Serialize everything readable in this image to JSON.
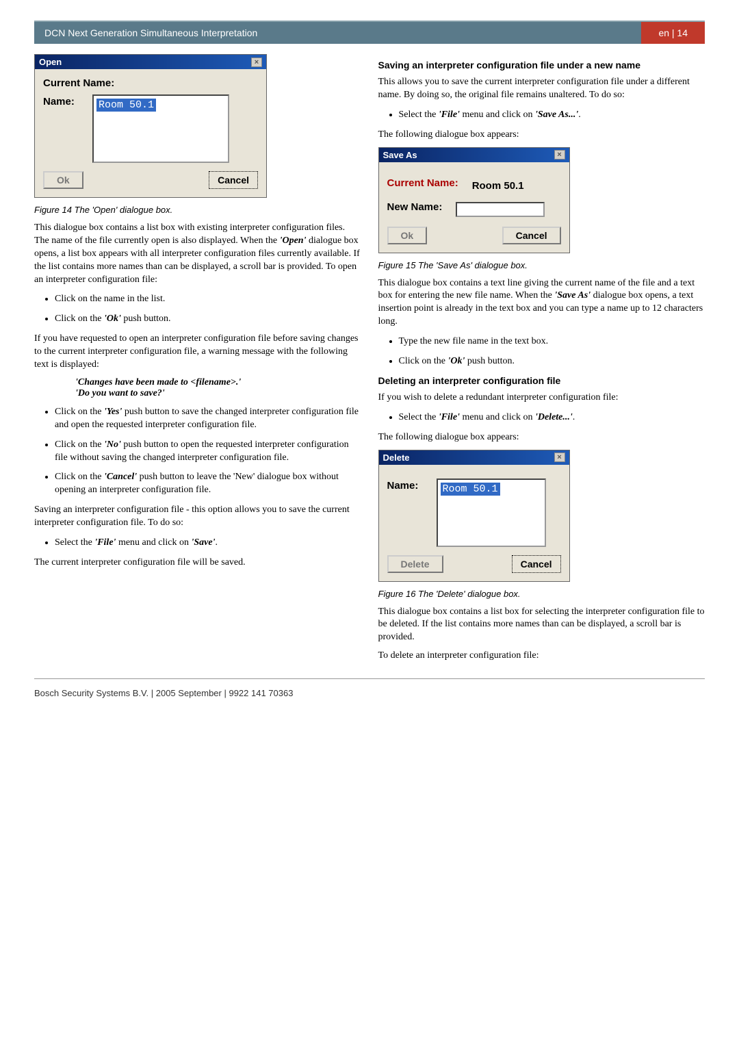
{
  "header": {
    "title": "DCN Next Generation Simultaneous Interpretation",
    "page": "en | 14"
  },
  "open_dialog": {
    "title": "Open",
    "current_name_label": "Current Name:",
    "name_label": "Name:",
    "list_value": "Room 50.1",
    "ok": "Ok",
    "cancel": "Cancel"
  },
  "fig14": "Figure 14 The 'Open' dialogue box.",
  "para1": "This dialogue box contains a list box with existing interpreter configuration files. The name of the file currently open is also displayed. When the ",
  "para1_em": "'Open'",
  "para1_cont": " dialogue box opens, a list box appears with all interpreter configuration files currently available. If the list contains more names than can be displayed, a scroll bar is provided. To open an interpreter configuration file:",
  "b1": "Click on the name in the list.",
  "b2a": "Click on the ",
  "ok_em": "'Ok'",
  "b2b": " push button.",
  "para2": "If you have requested to open an interpreter configuration file before saving changes to the current interpreter configuration file, a warning message with the following text is displayed:",
  "quote1": "'Changes have been made to <filename>.'",
  "quote2": "'Do you want to save?'",
  "b3a": "Click on the ",
  "yes_em": "'Yes'",
  "b3b": " push button to save the changed interpreter configuration file and open the requested interpreter configuration file.",
  "b4a": "Click on the ",
  "no_em": "'No'",
  "b4b": " push button to open the requested interpreter configuration file without saving the changed interpreter configuration file.",
  "b5a": "Click on the ",
  "cancel_em": "'Cancel'",
  "b5b": " push button to leave the 'New' dialogue box without opening an interpreter configuration file.",
  "para3": "Saving an interpreter configuration file - this option allows you to save the current interpreter configuration file. To do so:",
  "b6a": "Select the ",
  "file_em": "'File'",
  "b6b": " menu and click on ",
  "save_em": "'Save'",
  "b6c": ".",
  "para4": "The current interpreter configuration file will be saved.",
  "sec2_head": "Saving an interpreter configuration file under a new name",
  "sec2_p1": "This allows you to save the current interpreter configuration file under a different name. By doing so, the original file remains unaltered. To do so:",
  "b7a": "Select the ",
  "b7b": " menu and click on ",
  "saveas_em": "'Save As...'",
  "b7c": ".",
  "sec2_p2": "The following dialogue box appears:",
  "saveas_dialog": {
    "title": "Save As",
    "current_name_label": "Current Name:",
    "current_name_value": "Room 50.1",
    "new_name_label": "New Name:",
    "ok": "Ok",
    "cancel": "Cancel"
  },
  "fig15": "Figure 15 The 'Save As' dialogue box.",
  "sec2_p3a": "This dialogue box contains a text line giving the current name of the file and a text box for entering the new file name. When the ",
  "saveas_em2": "'Save As'",
  "sec2_p3b": " dialogue box opens, a text insertion point is already in the text box and you can type a name up to 12 characters long.",
  "b8": "Type the new file name in the text box.",
  "b9a": "Click on the ",
  "b9b": " push button.",
  "sec3_head": "Deleting an interpreter configuration file",
  "sec3_p1": "If you wish to delete a redundant interpreter configuration file:",
  "b10a": "Select the ",
  "b10b": " menu and click on ",
  "delete_em": "'Delete...'",
  "b10c": ".",
  "sec3_p2": "The following dialogue box appears:",
  "delete_dialog": {
    "title": "Delete",
    "name_label": "Name:",
    "list_value": "Room 50.1",
    "delete": "Delete",
    "cancel": "Cancel"
  },
  "fig16": "Figure 16 The 'Delete' dialogue box.",
  "sec3_p3": "This dialogue box contains a list box for selecting the interpreter configuration file to be deleted. If the list contains more names than can be displayed, a scroll bar is provided.",
  "sec3_p4": "To delete an interpreter configuration file:",
  "footer": "Bosch Security Systems B.V. | 2005 September | 9922 141 70363"
}
